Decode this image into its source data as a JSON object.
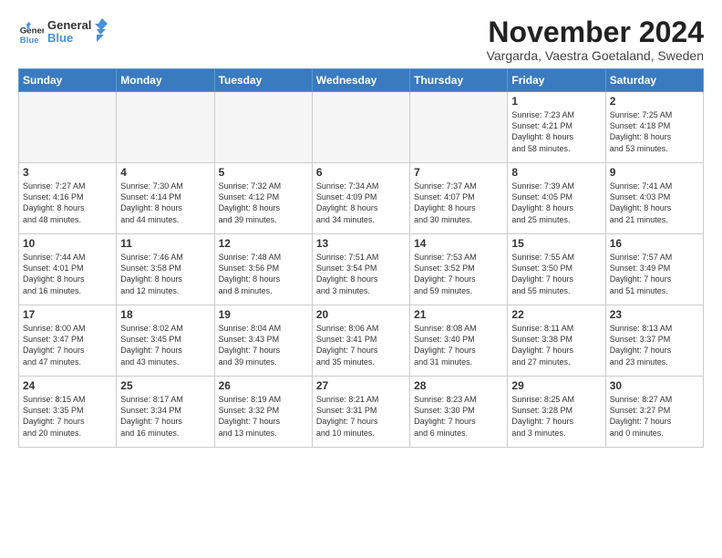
{
  "header": {
    "logo_line1": "General",
    "logo_line2": "Blue",
    "month": "November 2024",
    "location": "Vargarda, Vaestra Goetaland, Sweden"
  },
  "weekdays": [
    "Sunday",
    "Monday",
    "Tuesday",
    "Wednesday",
    "Thursday",
    "Friday",
    "Saturday"
  ],
  "weeks": [
    [
      {
        "day": "",
        "info": "",
        "empty": true
      },
      {
        "day": "",
        "info": "",
        "empty": true
      },
      {
        "day": "",
        "info": "",
        "empty": true
      },
      {
        "day": "",
        "info": "",
        "empty": true
      },
      {
        "day": "",
        "info": "",
        "empty": true
      },
      {
        "day": "1",
        "info": "Sunrise: 7:23 AM\nSunset: 4:21 PM\nDaylight: 8 hours\nand 58 minutes.",
        "empty": false
      },
      {
        "day": "2",
        "info": "Sunrise: 7:25 AM\nSunset: 4:18 PM\nDaylight: 8 hours\nand 53 minutes.",
        "empty": false
      }
    ],
    [
      {
        "day": "3",
        "info": "Sunrise: 7:27 AM\nSunset: 4:16 PM\nDaylight: 8 hours\nand 48 minutes.",
        "empty": false
      },
      {
        "day": "4",
        "info": "Sunrise: 7:30 AM\nSunset: 4:14 PM\nDaylight: 8 hours\nand 44 minutes.",
        "empty": false
      },
      {
        "day": "5",
        "info": "Sunrise: 7:32 AM\nSunset: 4:12 PM\nDaylight: 8 hours\nand 39 minutes.",
        "empty": false
      },
      {
        "day": "6",
        "info": "Sunrise: 7:34 AM\nSunset: 4:09 PM\nDaylight: 8 hours\nand 34 minutes.",
        "empty": false
      },
      {
        "day": "7",
        "info": "Sunrise: 7:37 AM\nSunset: 4:07 PM\nDaylight: 8 hours\nand 30 minutes.",
        "empty": false
      },
      {
        "day": "8",
        "info": "Sunrise: 7:39 AM\nSunset: 4:05 PM\nDaylight: 8 hours\nand 25 minutes.",
        "empty": false
      },
      {
        "day": "9",
        "info": "Sunrise: 7:41 AM\nSunset: 4:03 PM\nDaylight: 8 hours\nand 21 minutes.",
        "empty": false
      }
    ],
    [
      {
        "day": "10",
        "info": "Sunrise: 7:44 AM\nSunset: 4:01 PM\nDaylight: 8 hours\nand 16 minutes.",
        "empty": false
      },
      {
        "day": "11",
        "info": "Sunrise: 7:46 AM\nSunset: 3:58 PM\nDaylight: 8 hours\nand 12 minutes.",
        "empty": false
      },
      {
        "day": "12",
        "info": "Sunrise: 7:48 AM\nSunset: 3:56 PM\nDaylight: 8 hours\nand 8 minutes.",
        "empty": false
      },
      {
        "day": "13",
        "info": "Sunrise: 7:51 AM\nSunset: 3:54 PM\nDaylight: 8 hours\nand 3 minutes.",
        "empty": false
      },
      {
        "day": "14",
        "info": "Sunrise: 7:53 AM\nSunset: 3:52 PM\nDaylight: 7 hours\nand 59 minutes.",
        "empty": false
      },
      {
        "day": "15",
        "info": "Sunrise: 7:55 AM\nSunset: 3:50 PM\nDaylight: 7 hours\nand 55 minutes.",
        "empty": false
      },
      {
        "day": "16",
        "info": "Sunrise: 7:57 AM\nSunset: 3:49 PM\nDaylight: 7 hours\nand 51 minutes.",
        "empty": false
      }
    ],
    [
      {
        "day": "17",
        "info": "Sunrise: 8:00 AM\nSunset: 3:47 PM\nDaylight: 7 hours\nand 47 minutes.",
        "empty": false
      },
      {
        "day": "18",
        "info": "Sunrise: 8:02 AM\nSunset: 3:45 PM\nDaylight: 7 hours\nand 43 minutes.",
        "empty": false
      },
      {
        "day": "19",
        "info": "Sunrise: 8:04 AM\nSunset: 3:43 PM\nDaylight: 7 hours\nand 39 minutes.",
        "empty": false
      },
      {
        "day": "20",
        "info": "Sunrise: 8:06 AM\nSunset: 3:41 PM\nDaylight: 7 hours\nand 35 minutes.",
        "empty": false
      },
      {
        "day": "21",
        "info": "Sunrise: 8:08 AM\nSunset: 3:40 PM\nDaylight: 7 hours\nand 31 minutes.",
        "empty": false
      },
      {
        "day": "22",
        "info": "Sunrise: 8:11 AM\nSunset: 3:38 PM\nDaylight: 7 hours\nand 27 minutes.",
        "empty": false
      },
      {
        "day": "23",
        "info": "Sunrise: 8:13 AM\nSunset: 3:37 PM\nDaylight: 7 hours\nand 23 minutes.",
        "empty": false
      }
    ],
    [
      {
        "day": "24",
        "info": "Sunrise: 8:15 AM\nSunset: 3:35 PM\nDaylight: 7 hours\nand 20 minutes.",
        "empty": false
      },
      {
        "day": "25",
        "info": "Sunrise: 8:17 AM\nSunset: 3:34 PM\nDaylight: 7 hours\nand 16 minutes.",
        "empty": false
      },
      {
        "day": "26",
        "info": "Sunrise: 8:19 AM\nSunset: 3:32 PM\nDaylight: 7 hours\nand 13 minutes.",
        "empty": false
      },
      {
        "day": "27",
        "info": "Sunrise: 8:21 AM\nSunset: 3:31 PM\nDaylight: 7 hours\nand 10 minutes.",
        "empty": false
      },
      {
        "day": "28",
        "info": "Sunrise: 8:23 AM\nSunset: 3:30 PM\nDaylight: 7 hours\nand 6 minutes.",
        "empty": false
      },
      {
        "day": "29",
        "info": "Sunrise: 8:25 AM\nSunset: 3:28 PM\nDaylight: 7 hours\nand 3 minutes.",
        "empty": false
      },
      {
        "day": "30",
        "info": "Sunrise: 8:27 AM\nSunset: 3:27 PM\nDaylight: 7 hours\nand 0 minutes.",
        "empty": false
      }
    ]
  ]
}
